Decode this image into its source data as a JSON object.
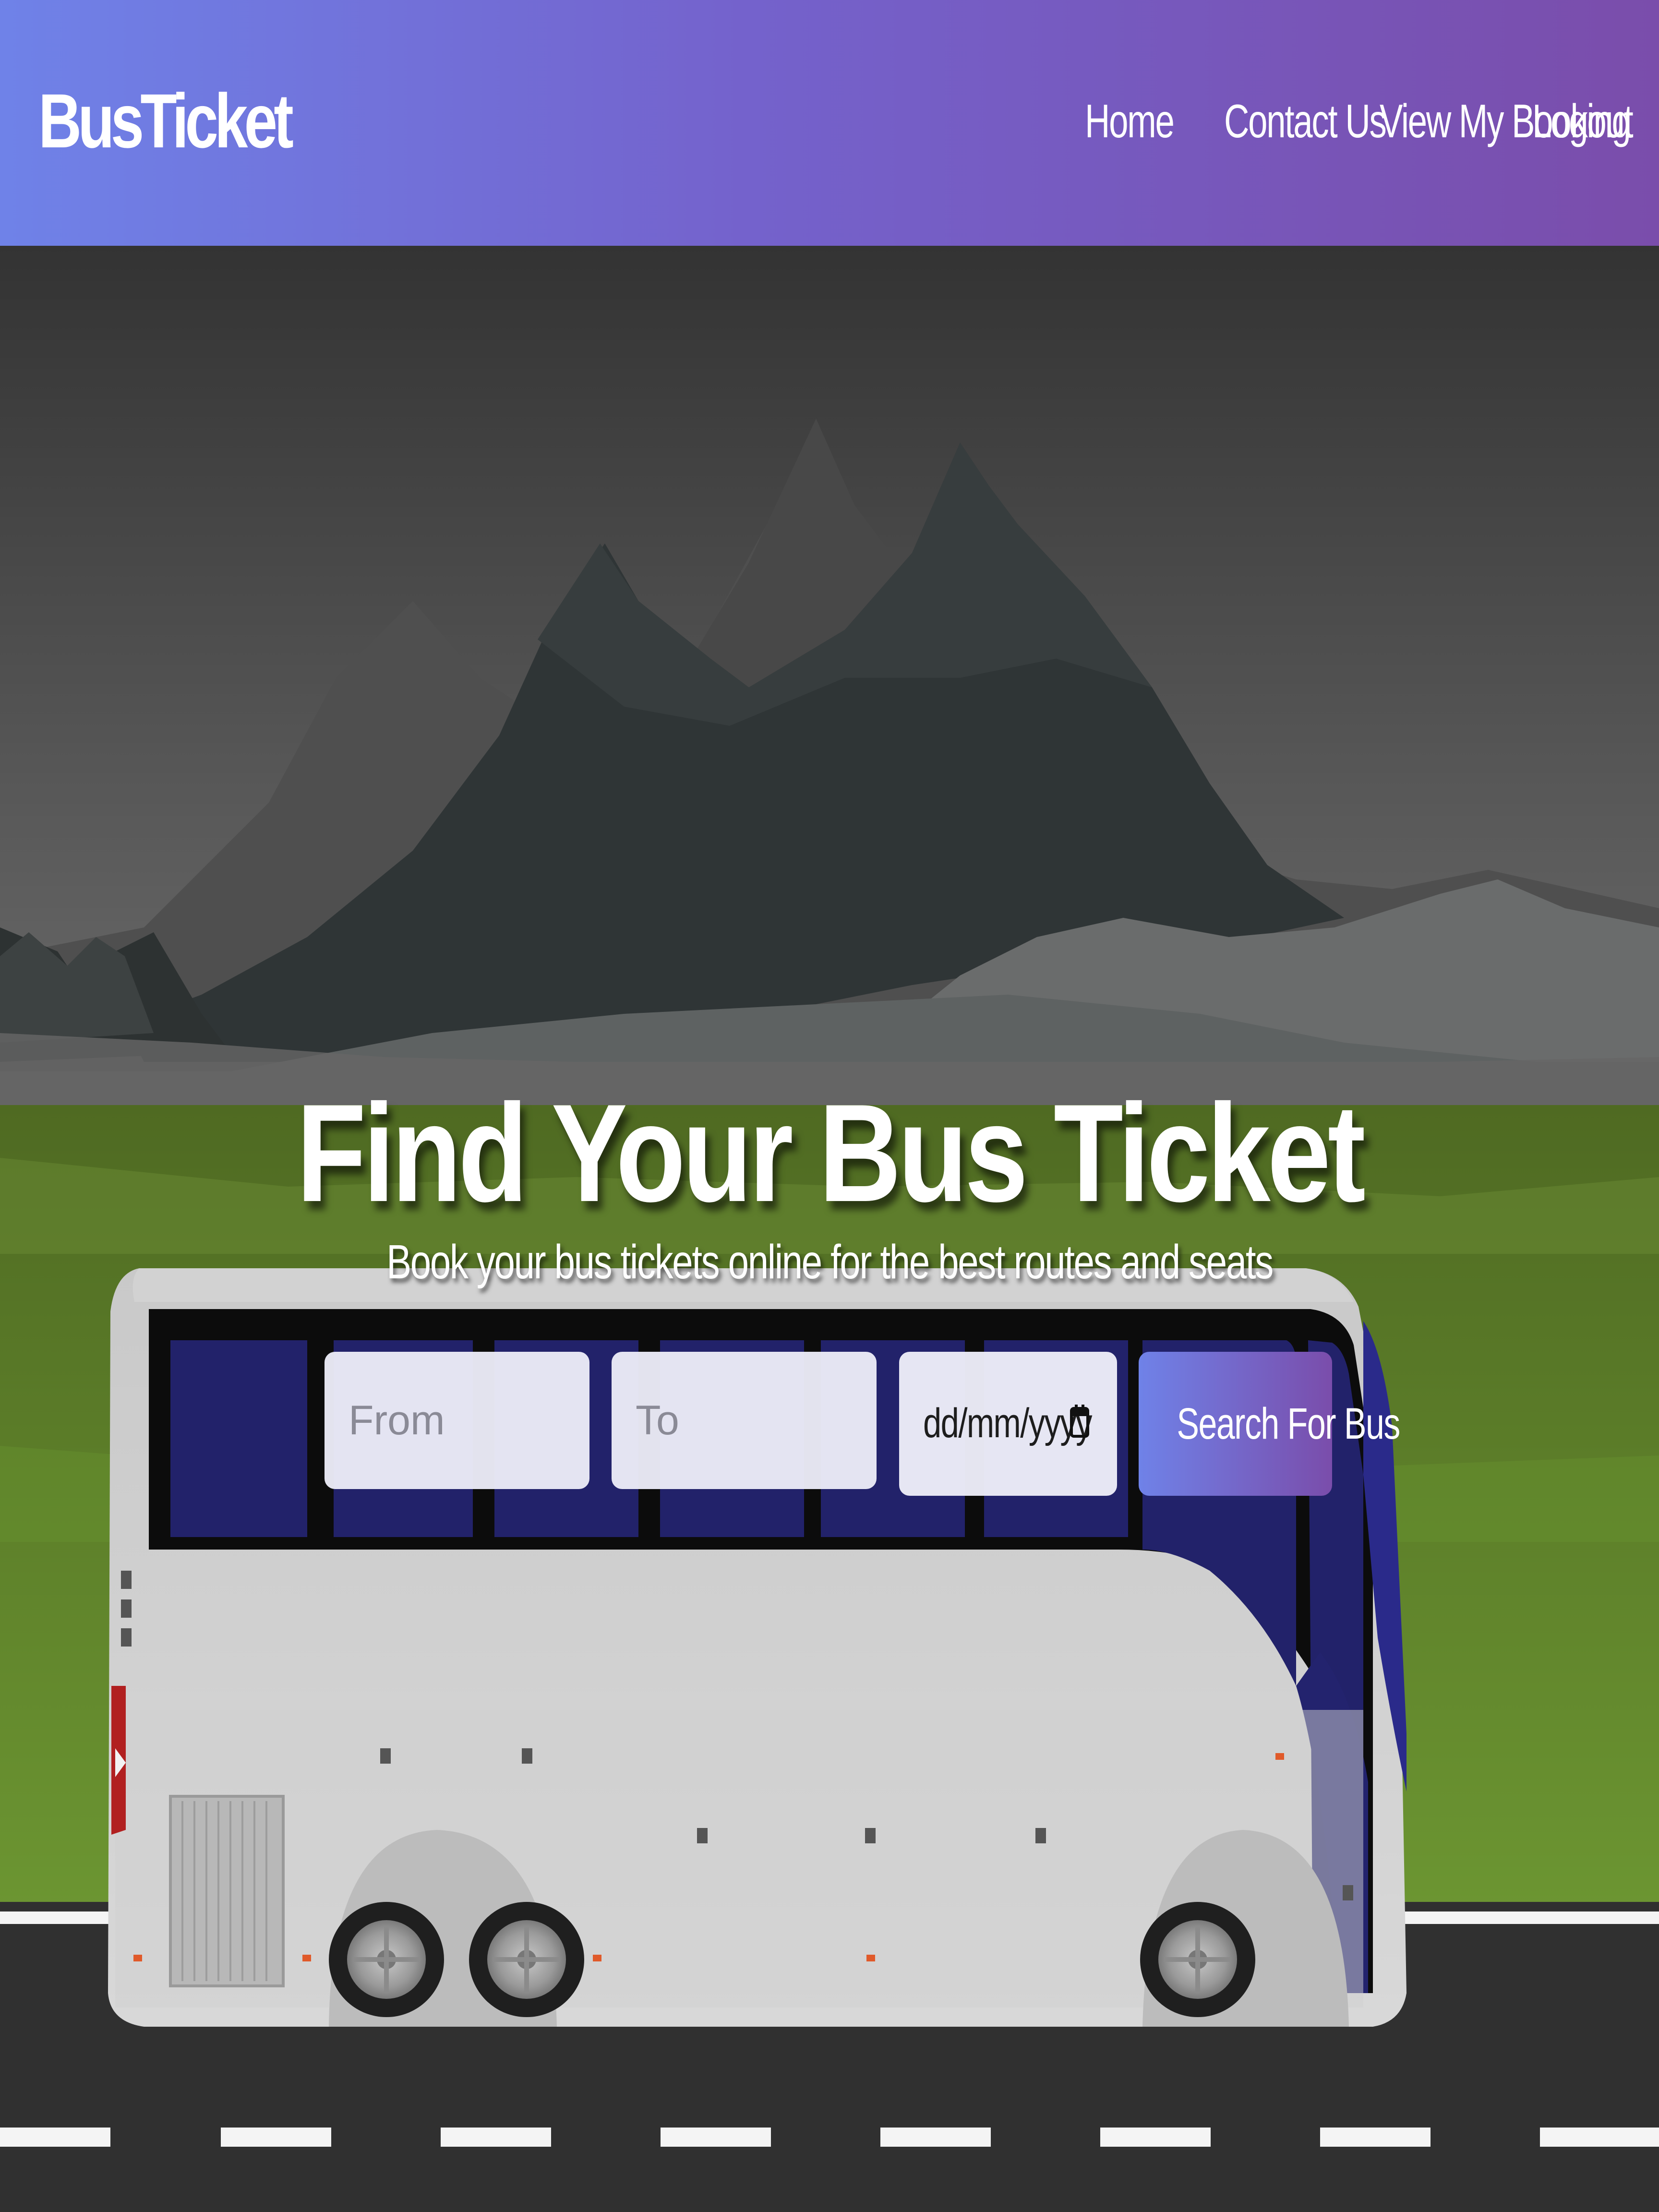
{
  "brand": {
    "name": "BusTicket"
  },
  "nav": {
    "items": [
      {
        "label": "Home"
      },
      {
        "label": "Contact Us"
      },
      {
        "label": "View My Booking"
      },
      {
        "label": "Logout"
      }
    ]
  },
  "hero": {
    "title": "Find Your Bus Ticket",
    "subtitle": "Book your bus tickets online for the best routes and seats"
  },
  "search": {
    "from_placeholder": "From",
    "from_value": "",
    "to_placeholder": "To",
    "to_value": "",
    "date_placeholder": "dd/mm/yyyy",
    "button_label": "Search For Bus"
  },
  "icons": {
    "calendar": "calendar-icon"
  },
  "colors": {
    "navbar_gradient_start": "#6f82e8",
    "navbar_gradient_end": "#7a4dab",
    "button_gradient_start": "#6f82e8",
    "button_gradient_end": "#7a4dab",
    "bus_window_blue": "#23236e",
    "grass_green": "#5e8a2c",
    "road": "#2f2f2f"
  }
}
